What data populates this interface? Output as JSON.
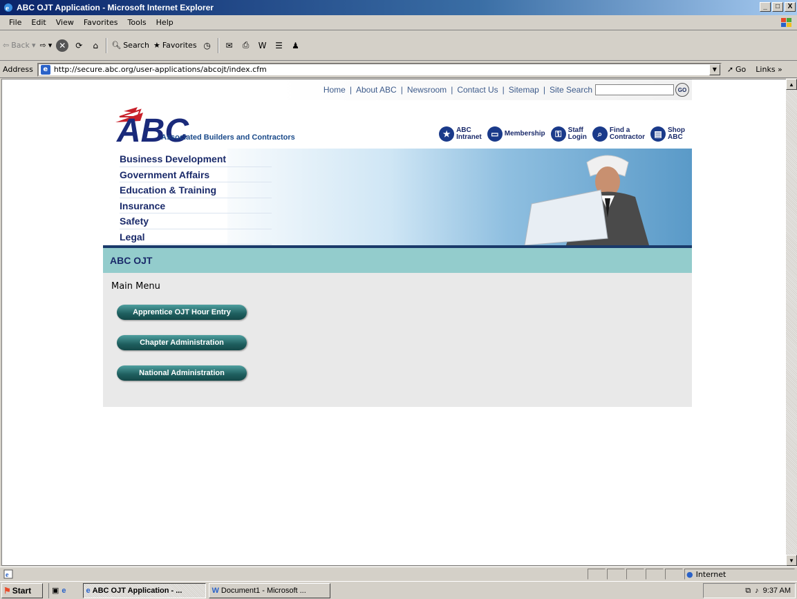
{
  "window": {
    "title": "ABC OJT Application - Microsoft Internet Explorer",
    "buttons": [
      "_",
      "□",
      "X"
    ]
  },
  "menubar": [
    "File",
    "Edit",
    "View",
    "Favorites",
    "Tools",
    "Help"
  ],
  "toolbar": {
    "back": "Back",
    "search": "Search",
    "favorites": "Favorites"
  },
  "address": {
    "label": "Address",
    "url": "http://secure.abc.org/user-applications/abcojt/index.cfm",
    "go": "Go",
    "links": "Links"
  },
  "site": {
    "topnav": [
      "Home",
      "About ABC",
      "Newsroom",
      "Contact Us",
      "Sitemap",
      "Site Search"
    ],
    "search_go": "GO",
    "logo_text": "Associated Builders and Contractors",
    "quicklinks": [
      {
        "label_top": "ABC",
        "label_bottom": "Intranet",
        "icon": "star-icon"
      },
      {
        "label_top": "Membership",
        "label_bottom": "",
        "icon": "card-icon"
      },
      {
        "label_top": "Staff",
        "label_bottom": "Login",
        "icon": "login-icon"
      },
      {
        "label_top": "Find a",
        "label_bottom": "Contractor",
        "icon": "magnifier-icon"
      },
      {
        "label_top": "Shop",
        "label_bottom": "ABC",
        "icon": "book-icon"
      }
    ],
    "mainnav": [
      "Business Development",
      "Government Affairs",
      "Education & Training",
      "Insurance",
      "Safety",
      "Legal"
    ],
    "section_title": "ABC OJT",
    "menu_title": "Main Menu",
    "buttons": [
      "Apprentice OJT Hour Entry",
      "Chapter Administration",
      "National Administration"
    ]
  },
  "status": {
    "zone": "Internet"
  },
  "taskbar": {
    "start": "Start",
    "tasks": [
      "ABC OJT Application - ...",
      "Document1 - Microsoft ..."
    ],
    "clock": "9:37 AM"
  }
}
